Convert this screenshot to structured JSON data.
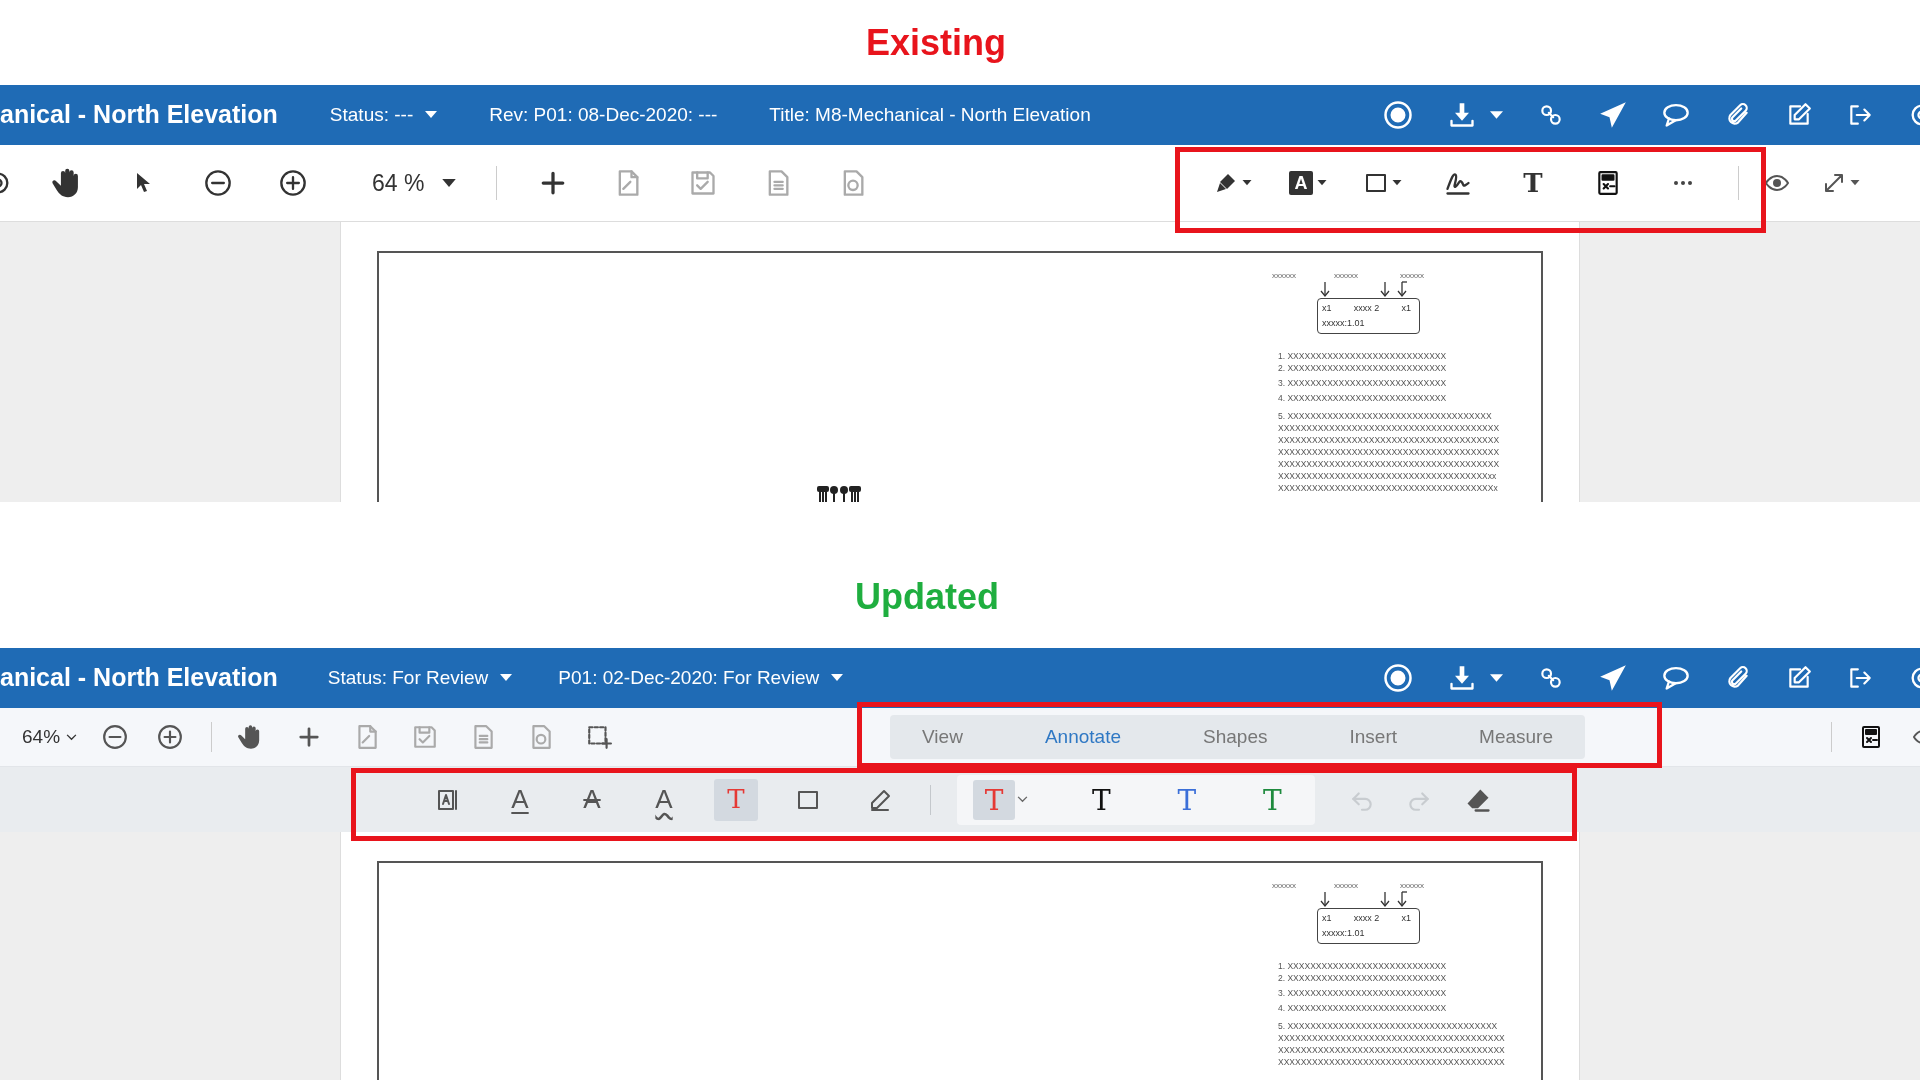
{
  "panels": [
    {
      "kind": "existing",
      "heading": "Existing",
      "color": "#e8141c",
      "header": {
        "title": "anical - North Elevation",
        "fields": [
          {
            "text": "Status: ---",
            "dropdown": true
          },
          {
            "text": "Rev: P01: 08-Dec-2020: ---",
            "dropdown": false
          },
          {
            "text": "Title: M8-Mechanical - North Elevation",
            "dropdown": false
          }
        ]
      },
      "zoom": "64 %",
      "markup_tools": [
        {
          "kind": "highlighter"
        },
        {
          "kind": "letter_box",
          "glyph": "A"
        },
        {
          "kind": "rectangle"
        },
        {
          "kind": "signature"
        },
        {
          "kind": "letter",
          "glyph": "T"
        },
        {
          "kind": "calculator"
        },
        {
          "kind": "more"
        }
      ],
      "document": {
        "symbols": true,
        "labels": [
          "xxxxxx",
          "xxxxxx",
          "xxxxxx"
        ],
        "box": {
          "cells": [
            "x1",
            "xxxx 2",
            "x1"
          ],
          "ratio": "xxxxx:1.01"
        },
        "notes": [
          {
            "lines": [
              "1. XXXXXXXXXXXXXXXXXXXXXXXXXXXX"
            ]
          },
          {
            "lines": [
              "2. XXXXXXXXXXXXXXXXXXXXXXXXXXXX"
            ]
          },
          {
            "lines": [
              "3. XXXXXXXXXXXXXXXXXXXXXXXXXXXX"
            ]
          },
          {
            "lines": [
              "4. XXXXXXXXXXXXXXXXXXXXXXXXXXXX"
            ]
          },
          {
            "lines": [
              "5. XXXXXXXXXXXXXXXXXXXXXXXXXXXXXXXXXXXX",
              "XXXXXXXXXXXXXXXXXXXXXXXXXXXXXXXXXXXXXXX",
              "XXXXXXXXXXXXXXXXXXXXXXXXXXXXXXXXXXXXXXX",
              "XXXXXXXXXXXXXXXXXXXXXXXXXXXXXXXXXXXXXXX",
              "XXXXXXXXXXXXXXXXXXXXXXXXXXXXXXXXXXXXXXX",
              "XXXXXXXXXXXXXXXXXXXXXXXXXXXXXXXXXXXXXxx",
              "XXXXXXXXXXXXXXXXXXXXXXXXXXXXXXXXXXXXXXx"
            ]
          }
        ]
      }
    },
    {
      "kind": "updated",
      "heading": "Updated",
      "color": "#1fae3f",
      "header": {
        "title": "anical - North Elevation",
        "fields": [
          {
            "text": "Status: For Review",
            "dropdown": true
          },
          {
            "text": "P01: 02-Dec-2020: For Review",
            "dropdown": true
          }
        ]
      },
      "zoom": "64%",
      "tabs": [
        {
          "label": "View",
          "selected": false
        },
        {
          "label": "Annotate",
          "selected": true
        },
        {
          "label": "Shapes",
          "selected": false
        },
        {
          "label": "Insert",
          "selected": false
        },
        {
          "label": "Measure",
          "selected": false
        }
      ],
      "annotate_tools": [
        {
          "kind": "textbox",
          "selected": false
        },
        {
          "kind": "underline",
          "glyph": "A",
          "selected": false
        },
        {
          "kind": "strikethrough",
          "glyph": "A",
          "selected": false
        },
        {
          "kind": "squiggly",
          "glyph": "A",
          "selected": false
        },
        {
          "kind": "text",
          "glyph": "T",
          "selected": true
        },
        {
          "kind": "rectangle",
          "selected": false
        },
        {
          "kind": "pencil",
          "selected": false
        }
      ],
      "text_colors": [
        {
          "glyph": "T",
          "color": "#e53935",
          "selected": true
        },
        {
          "glyph": "T",
          "color": "#111111",
          "selected": false
        },
        {
          "glyph": "T",
          "color": "#3b6fd8",
          "selected": false
        },
        {
          "glyph": "T",
          "color": "#1e8a3e",
          "selected": false
        }
      ],
      "history": [
        {
          "kind": "undo",
          "disabled": true
        },
        {
          "kind": "redo",
          "disabled": true
        }
      ],
      "document": {
        "labels": [
          "xxxxxx",
          "xxxxxx",
          "xxxxxx"
        ],
        "box": {
          "cells": [
            "x1",
            "xxxx 2",
            "x1"
          ],
          "ratio": "xxxxx:1.01"
        },
        "notes": [
          {
            "lines": [
              "1. XXXXXXXXXXXXXXXXXXXXXXXXXXXX"
            ]
          },
          {
            "lines": [
              "2. XXXXXXXXXXXXXXXXXXXXXXXXXXXX"
            ]
          },
          {
            "lines": [
              "3. XXXXXXXXXXXXXXXXXXXXXXXXXXXX"
            ]
          },
          {
            "lines": [
              "4. XXXXXXXXXXXXXXXXXXXXXXXXXXXX"
            ]
          },
          {
            "lines": [
              "5. XXXXXXXXXXXXXXXXXXXXXXXXXXXXXXXXXXXXX",
              "XXXXXXXXXXXXXXXXXXXXXXXXXXXXXXXXXXXXXXXX",
              "XXXXXXXXXXXXXXXXXXXXXXXXXXXXXXXXXXXXXXXX",
              "XXXXXXXXXXXXXXXXXXXXXXXXXXXXXXXXXXXXXXXX"
            ]
          }
        ]
      }
    }
  ]
}
